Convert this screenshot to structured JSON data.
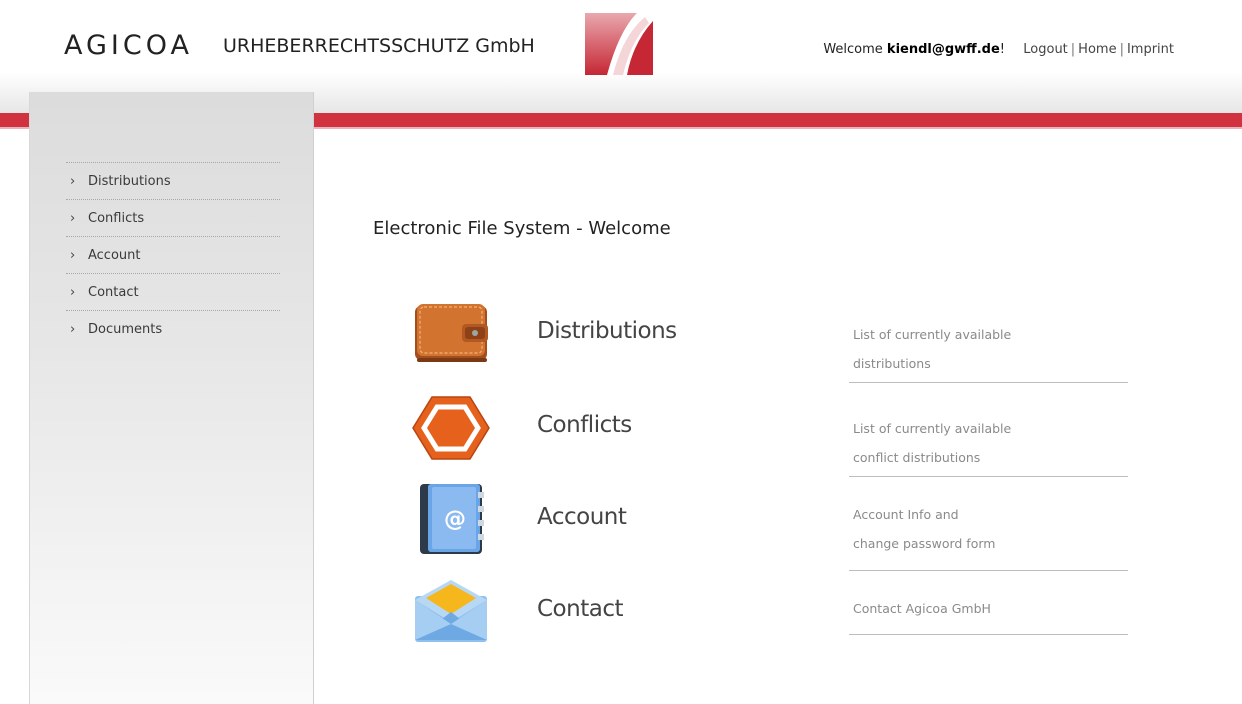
{
  "header": {
    "brand_name": "AGICOA",
    "brand_sub": "URHEBERRECHTSSCHUTZ GmbH",
    "welcome_prefix": "Welcome ",
    "user_email": "kiendl@gwff.de",
    "welcome_suffix": "!",
    "links": {
      "logout": "Logout",
      "home": "Home",
      "imprint": "Imprint"
    },
    "accent_color": "#d1323f"
  },
  "sidebar": {
    "items": [
      {
        "label": "Distributions"
      },
      {
        "label": "Conflicts"
      },
      {
        "label": "Account"
      },
      {
        "label": "Contact"
      },
      {
        "label": "Documents"
      }
    ]
  },
  "main": {
    "title": "Electronic File System - Welcome",
    "features": [
      {
        "icon": "wallet-icon",
        "name": "Distributions",
        "desc_line1": "List of currently available",
        "desc_line2": "distributions"
      },
      {
        "icon": "hexagon-icon",
        "name": "Conflicts",
        "desc_line1": "List of currently available",
        "desc_line2": "conflict distributions"
      },
      {
        "icon": "address-book-icon",
        "name": "Account",
        "desc_line1": "Account Info and",
        "desc_line2": "change password form"
      },
      {
        "icon": "envelope-icon",
        "name": "Contact",
        "desc_line1": "Contact Agicoa GmbH",
        "desc_line2": ""
      }
    ]
  }
}
